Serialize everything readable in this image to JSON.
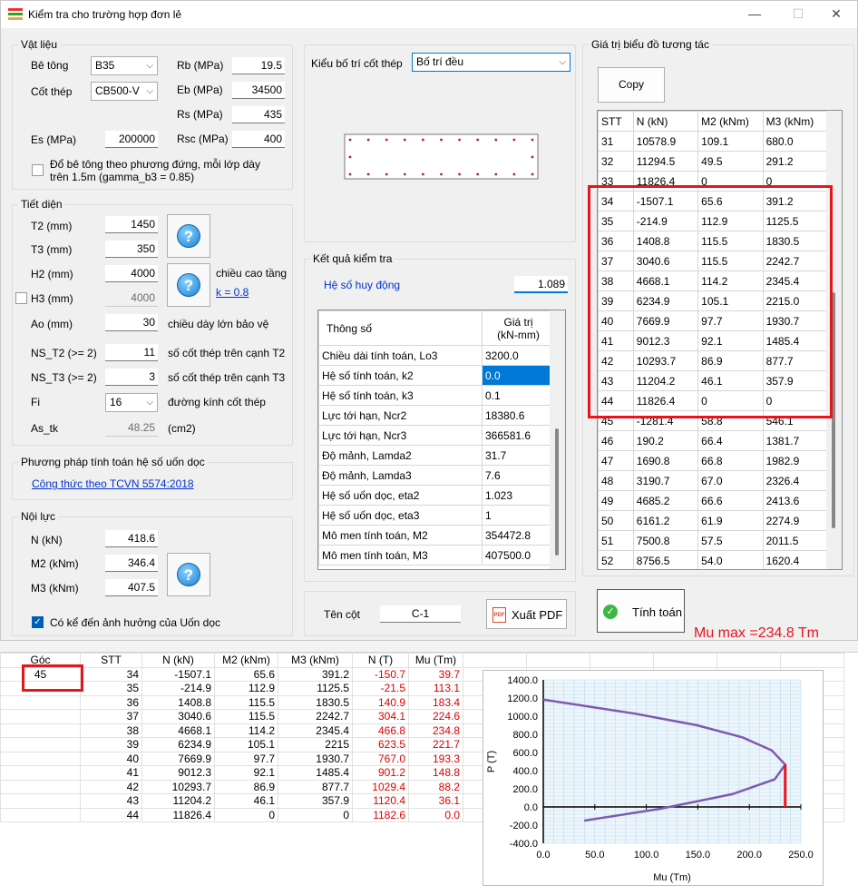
{
  "window": {
    "title": "Kiểm tra cho trường hợp đơn lẻ",
    "minimize": "—",
    "maximize": "☐",
    "close": "✕"
  },
  "material": {
    "group_label": "Vật liệu",
    "concrete_label": "Bê tông",
    "concrete_value": "B35",
    "steel_label": "Cốt thép",
    "steel_value": "CB500-V",
    "rb_label": "Rb (MPa)",
    "rb_value": "19.5",
    "eb_label": "Eb (MPa)",
    "eb_value": "34500",
    "rs_label": "Rs (MPa)",
    "rs_value": "435",
    "es_label": "Es (MPa)",
    "es_value": "200000",
    "rsc_label": "Rsc (MPa)",
    "rsc_value": "400",
    "gamma_note_line1": "Đổ bê tông theo phương đứng, mỗi lớp dày",
    "gamma_note_line2": "trên 1.5m (gamma_b3 = 0.85)"
  },
  "section": {
    "group_label": "Tiết diện",
    "t2_label": "T2 (mm)",
    "t2_value": "1450",
    "t3_label": "T3 (mm)",
    "t3_value": "350",
    "h2_label": "H2 (mm)",
    "h2_value": "4000",
    "h3_label": "H3 (mm)",
    "h3_value": "4000",
    "floor_height_label": "chiều cao tầng",
    "k_link": "k = 0.8",
    "ao_label": "Ao (mm)",
    "ao_value": "30",
    "ao_note": "chiều dày lớn bảo vệ",
    "ns_t2_label": "NS_T2 (>= 2)",
    "ns_t2_value": "11",
    "ns_t2_note": "số cốt thép trên cạnh T2",
    "ns_t3_label": "NS_T3 (>= 2)",
    "ns_t3_value": "3",
    "ns_t3_note": "số cốt thép trên cạnh T3",
    "fi_label": "Fi",
    "fi_value": "16",
    "fi_note": "đường kính cốt thép",
    "as_label": "As_tk",
    "as_value": "48.25",
    "as_unit": "(cm2)"
  },
  "method": {
    "group_label": "Phương pháp tính toán hệ số uốn dọc",
    "link": "Công thức theo TCVN 5574:2018"
  },
  "forces": {
    "group_label": "Nội lực",
    "n_label": "N (kN)",
    "n_value": "418.6",
    "m2_label": "M2 (kNm)",
    "m2_value": "346.4",
    "m3_label": "M3 (kNm)",
    "m3_value": "407.5",
    "buckling_label": "Có kể đến ảnh hưởng của Uốn dọc"
  },
  "layout": {
    "label": "Kiểu bố trí cốt thép",
    "value": "Bố trí đều"
  },
  "result": {
    "group_label": "Kết quả kiểm tra",
    "factor_label": "Hệ số huy động",
    "factor_value": "1.089",
    "header_param": "Thông số",
    "header_value_1": "Giá trị",
    "header_value_2": "(kN-mm)",
    "rows": [
      {
        "name": "Chiều dài tính toán, Lo3",
        "value": "3200.0"
      },
      {
        "name": "Hệ số tính toán, k2",
        "value": "0.0"
      },
      {
        "name": "Hệ số tính toán, k3",
        "value": "0.1"
      },
      {
        "name": "Lực tới hạn, Ncr2",
        "value": "18380.6"
      },
      {
        "name": "Lực tới hạn, Ncr3",
        "value": "366581.6"
      },
      {
        "name": "Độ mảnh, Lamda2",
        "value": "31.7"
      },
      {
        "name": "Độ mảnh, Lamda3",
        "value": "7.6"
      },
      {
        "name": "Hệ số uốn dọc, eta2",
        "value": "1.023"
      },
      {
        "name": "Hệ số uốn dọc, eta3",
        "value": "1"
      },
      {
        "name": "Mô men tính toán, M2",
        "value": "354472.8"
      },
      {
        "name": "Mô men tính toán, M3",
        "value": "407500.0"
      }
    ]
  },
  "column": {
    "label": "Tên cột",
    "value": "C-1",
    "export_label": "Xuất PDF",
    "pdf_icon_text": "PDF"
  },
  "interaction": {
    "group_label": "Giá trị biểu đồ tương tác",
    "copy_label": "Copy",
    "headers": [
      "STT",
      "N (kN)",
      "M2 (kNm)",
      "M3 (kNm)"
    ],
    "rows": [
      [
        "31",
        "10578.9",
        "109.1",
        "680.0"
      ],
      [
        "32",
        "11294.5",
        "49.5",
        "291.2"
      ],
      [
        "33",
        "11826.4",
        "0",
        "0"
      ],
      [
        "34",
        "-1507.1",
        "65.6",
        "391.2"
      ],
      [
        "35",
        "-214.9",
        "112.9",
        "1125.5"
      ],
      [
        "36",
        "1408.8",
        "115.5",
        "1830.5"
      ],
      [
        "37",
        "3040.6",
        "115.5",
        "2242.7"
      ],
      [
        "38",
        "4668.1",
        "114.2",
        "2345.4"
      ],
      [
        "39",
        "6234.9",
        "105.1",
        "2215.0"
      ],
      [
        "40",
        "7669.9",
        "97.7",
        "1930.7"
      ],
      [
        "41",
        "9012.3",
        "92.1",
        "1485.4"
      ],
      [
        "42",
        "10293.7",
        "86.9",
        "877.7"
      ],
      [
        "43",
        "11204.2",
        "46.1",
        "357.9"
      ],
      [
        "44",
        "11826.4",
        "0",
        "0"
      ],
      [
        "45",
        "-1281.4",
        "58.8",
        "546.1"
      ],
      [
        "46",
        "190.2",
        "66.4",
        "1381.7"
      ],
      [
        "47",
        "1690.8",
        "66.8",
        "1982.9"
      ],
      [
        "48",
        "3190.7",
        "67.0",
        "2326.4"
      ],
      [
        "49",
        "4685.2",
        "66.6",
        "2413.6"
      ],
      [
        "50",
        "6161.2",
        "61.9",
        "2274.9"
      ],
      [
        "51",
        "7500.8",
        "57.5",
        "2011.5"
      ],
      [
        "52",
        "8756.5",
        "54.0",
        "1620.4"
      ]
    ]
  },
  "calc_label": "Tính toán",
  "mu_max_text": "Mu max =234.8 Tm",
  "sheet": {
    "headers": [
      "Góc",
      "STT",
      "N (kN)",
      "M2 (kNm)",
      "M3 (kNm)",
      "N (T)",
      "Mu (Tm)"
    ],
    "angle": "45",
    "rows": [
      [
        "34",
        "-1507.1",
        "65.6",
        "391.2",
        "-150.7",
        "39.7"
      ],
      [
        "35",
        "-214.9",
        "112.9",
        "1125.5",
        "-21.5",
        "113.1"
      ],
      [
        "36",
        "1408.8",
        "115.5",
        "1830.5",
        "140.9",
        "183.4"
      ],
      [
        "37",
        "3040.6",
        "115.5",
        "2242.7",
        "304.1",
        "224.6"
      ],
      [
        "38",
        "4668.1",
        "114.2",
        "2345.4",
        "466.8",
        "234.8"
      ],
      [
        "39",
        "6234.9",
        "105.1",
        "2215",
        "623.5",
        "221.7"
      ],
      [
        "40",
        "7669.9",
        "97.7",
        "1930.7",
        "767.0",
        "193.3"
      ],
      [
        "41",
        "9012.3",
        "92.1",
        "1485.4",
        "901.2",
        "148.8"
      ],
      [
        "42",
        "10293.7",
        "86.9",
        "877.7",
        "1029.4",
        "88.2"
      ],
      [
        "43",
        "11204.2",
        "46.1",
        "357.9",
        "1120.4",
        "36.1"
      ],
      [
        "44",
        "11826.4",
        "0",
        "0",
        "1182.6",
        "0.0"
      ]
    ]
  },
  "chart_data": {
    "type": "line",
    "xlabel": "Mu (Tm)",
    "ylabel": "P (T)",
    "xlim": [
      0,
      250
    ],
    "ylim": [
      -400,
      1400
    ],
    "x_ticks": [
      "0.0",
      "50.0",
      "100.0",
      "150.0",
      "200.0",
      "250.0"
    ],
    "y_ticks": [
      "1400.0",
      "1200.0",
      "1000.0",
      "800.0",
      "600.0",
      "400.0",
      "200.0",
      "0.0",
      "-200.0",
      "-400.0"
    ],
    "series": [
      {
        "values_x": [
          39.7,
          113.1,
          183.4,
          224.6,
          234.8,
          221.7,
          193.3,
          148.8,
          88.2,
          36.1,
          0.0
        ],
        "values_y": [
          -150.7,
          -21.5,
          140.9,
          304.1,
          466.8,
          623.5,
          767.0,
          901.2,
          1029.4,
          1120.4,
          1182.6
        ],
        "color": "#7e5ab0"
      }
    ],
    "marker": {
      "x": 234.8,
      "y_from": 0,
      "y_to": 466.8,
      "color": "#e8141e"
    },
    "grid": true
  }
}
